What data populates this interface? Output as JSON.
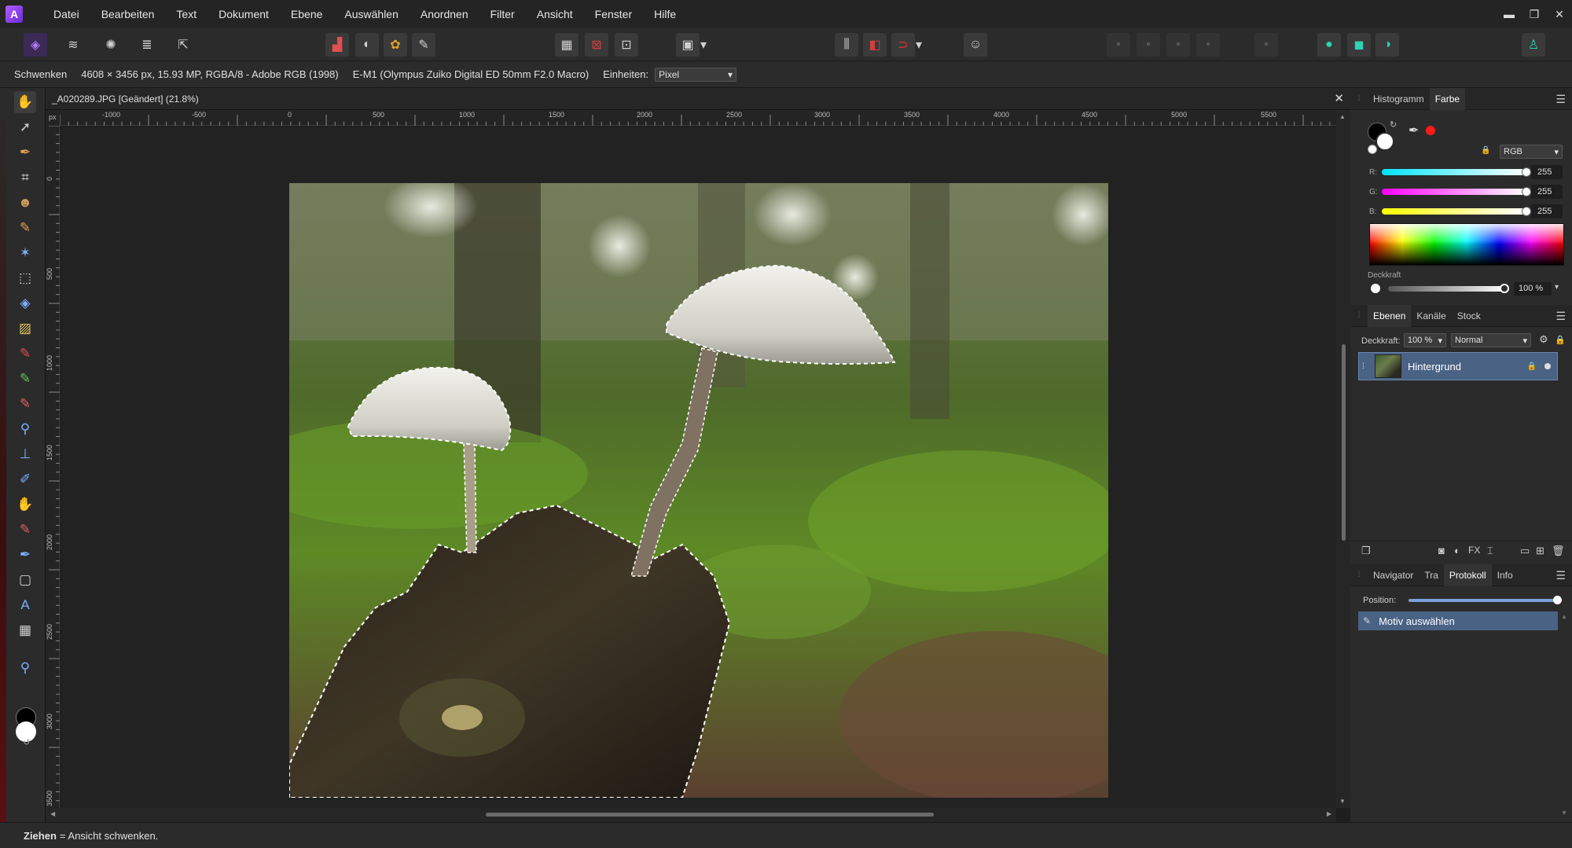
{
  "menu": {
    "items": [
      "Datei",
      "Bearbeiten",
      "Text",
      "Dokument",
      "Ebene",
      "Auswählen",
      "Anordnen",
      "Filter",
      "Ansicht",
      "Fenster",
      "Hilfe"
    ]
  },
  "icons": {
    "app": "affinity-photo-icon",
    "minimize": "minimize-icon",
    "maximize": "restore-icon",
    "close": "close-icon"
  },
  "context": {
    "tool": "Schwenken",
    "image_info": "4608 × 3456 px, 15.93 MP, RGBA/8 - Adobe RGB (1998)",
    "camera": "E-M1 (Olympus Zuiko Digital ED 50mm F2.0 Macro)",
    "units_label": "Einheiten:",
    "units_value": "Pixel"
  },
  "document": {
    "title": "_A020289.JPG [Geändert] (21.8%)",
    "ruler_unit": "px",
    "ruler_h_labels": [
      "-1000",
      "-500",
      "0",
      "500",
      "1000",
      "1500",
      "2000",
      "2500",
      "3000",
      "3500",
      "4000",
      "4500",
      "5000",
      "5500"
    ],
    "ruler_v_labels": [
      "0",
      "500",
      "1000",
      "1500",
      "2000",
      "2500",
      "3000",
      "3500"
    ]
  },
  "color_panel": {
    "tabs": [
      "Histogramm",
      "Farbe"
    ],
    "active_tab": "Farbe",
    "model": "RGB",
    "r_label": "R:",
    "g_label": "G:",
    "b_label": "B:",
    "r": "255",
    "g": "255",
    "b": "255",
    "opacity_label": "Deckkraft",
    "opacity_value": "100 %",
    "accent_red": "#ff1a1a"
  },
  "layers_panel": {
    "tabs": [
      "Ebenen",
      "Kanäle",
      "Stock"
    ],
    "active_tab": "Ebenen",
    "opacity_label": "Deckkraft:",
    "opacity_value": "100 %",
    "blend_mode": "Normal",
    "layer_name": "Hintergrund"
  },
  "history_panel": {
    "tabs": [
      "Navigator",
      "Tra",
      "Protokoll",
      "Info"
    ],
    "active_tab": "Protokoll",
    "position_label": "Position:",
    "position_fraction": 1.0,
    "entry": "Motiv auswählen"
  },
  "status": {
    "bold": "Ziehen",
    "text": "= Ansicht schwenken."
  }
}
